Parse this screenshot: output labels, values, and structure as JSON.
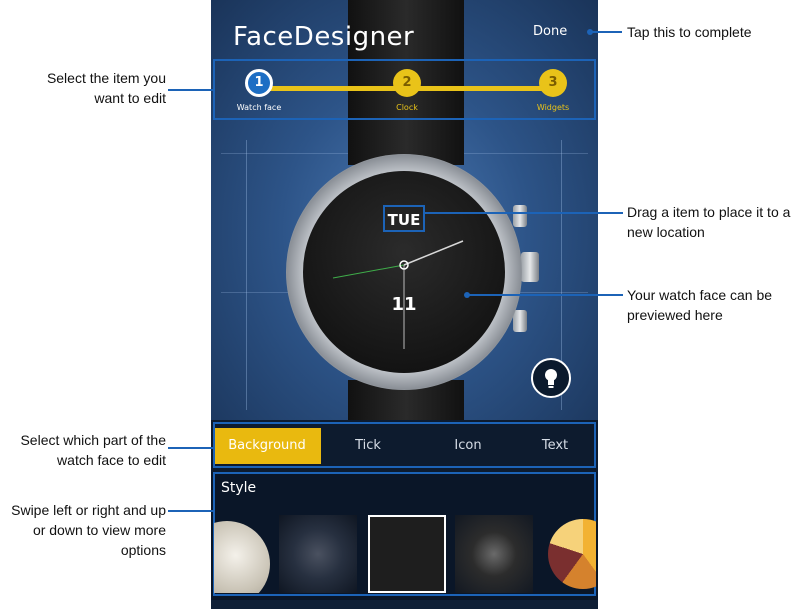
{
  "app": {
    "title": "FaceDesigner",
    "done_label": "Done"
  },
  "steps": [
    {
      "number": "1",
      "label": "Watch face",
      "active": true
    },
    {
      "number": "2",
      "label": "Clock",
      "active": false
    },
    {
      "number": "3",
      "label": "Widgets",
      "active": false
    }
  ],
  "preview": {
    "day": "TUE",
    "date": "11",
    "light_icon": "lightbulb-icon"
  },
  "tabs": [
    {
      "label": "Background",
      "active": true
    },
    {
      "label": "Tick",
      "active": false
    },
    {
      "label": "Icon",
      "active": false
    },
    {
      "label": "Text",
      "active": false
    }
  ],
  "style": {
    "label": "Style",
    "selected_index": 2
  },
  "callouts": {
    "done": "Tap this to complete",
    "steps": "Select the item you want to edit",
    "drag": "Drag a item to place it to a new location",
    "preview": "Your watch face can be previewed here",
    "tabs": "Select which part of the watch face to edit",
    "swipe": "Swipe left or right and up or down to view more options"
  },
  "colors": {
    "accent_yellow": "#e9c319",
    "callout_blue": "#1c63b7"
  }
}
